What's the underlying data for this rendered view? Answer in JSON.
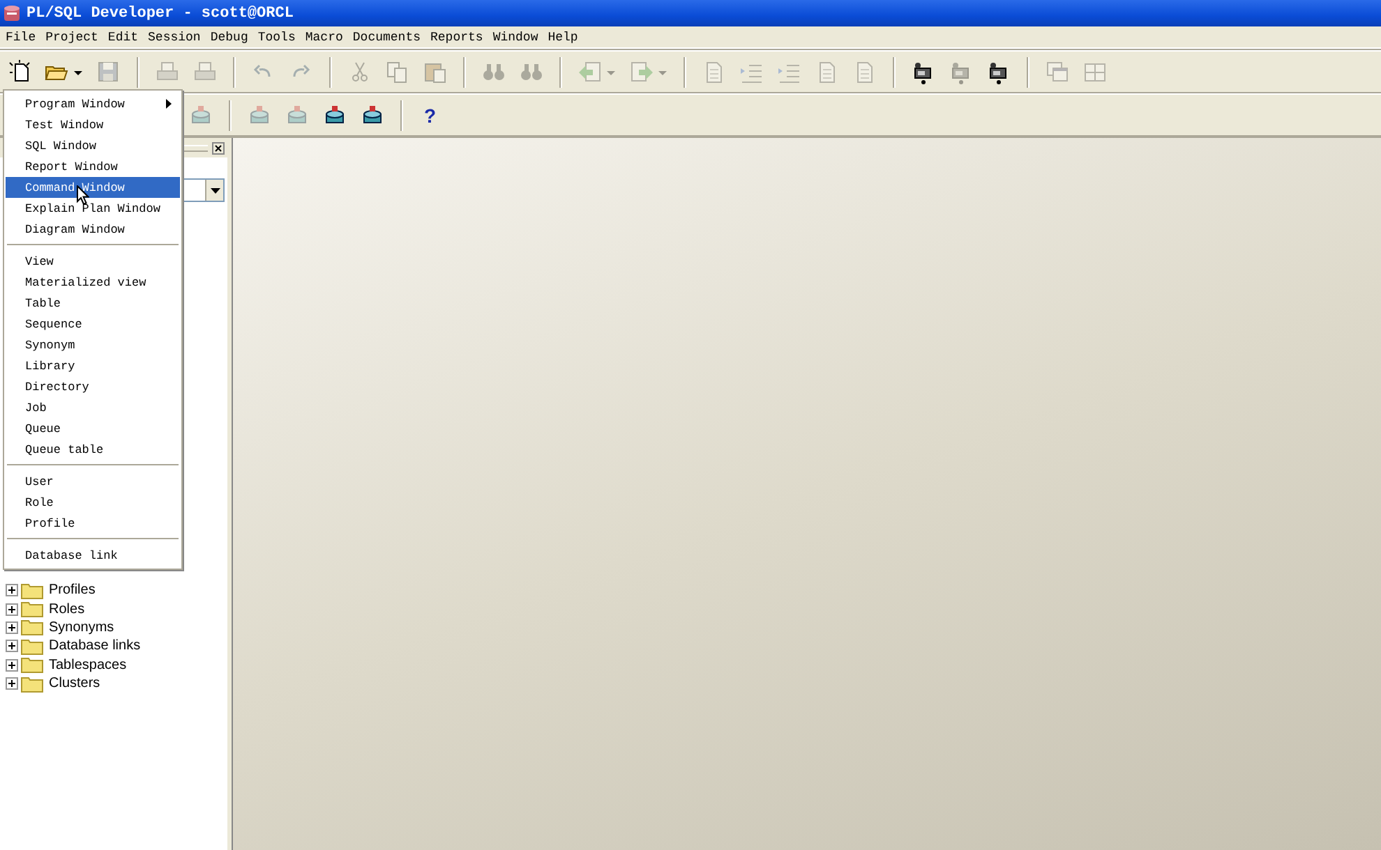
{
  "window": {
    "title": "PL/SQL Developer - scott@ORCL"
  },
  "menu_bar": [
    {
      "label": "File"
    },
    {
      "label": "Project"
    },
    {
      "label": "Edit"
    },
    {
      "label": "Session"
    },
    {
      "label": "Debug"
    },
    {
      "label": "Tools"
    },
    {
      "label": "Macro"
    },
    {
      "label": "Documents"
    },
    {
      "label": "Reports"
    },
    {
      "label": "Window"
    },
    {
      "label": "Help"
    }
  ],
  "toolbars": [
    [
      {
        "kind": "new",
        "disabled": false
      },
      {
        "kind": "open",
        "disabled": false
      },
      {
        "kind": "dropdown",
        "disabled": false
      },
      {
        "kind": "save",
        "disabled": true
      },
      {
        "kind": "separator"
      },
      {
        "kind": "print",
        "disabled": true
      },
      {
        "kind": "print",
        "disabled": true
      },
      {
        "kind": "separator"
      },
      {
        "kind": "undo",
        "disabled": true
      },
      {
        "kind": "redo",
        "disabled": true
      },
      {
        "kind": "separator"
      },
      {
        "kind": "cut",
        "disabled": true
      },
      {
        "kind": "copy",
        "disabled": true
      },
      {
        "kind": "paste",
        "disabled": true
      },
      {
        "kind": "separator"
      },
      {
        "kind": "find",
        "disabled": true
      },
      {
        "kind": "find",
        "disabled": true
      },
      {
        "kind": "separator"
      },
      {
        "kind": "back",
        "disabled": true
      },
      {
        "kind": "dropdown",
        "disabled": true
      },
      {
        "kind": "forward",
        "disabled": true
      },
      {
        "kind": "dropdown",
        "disabled": true
      },
      {
        "kind": "separator"
      },
      {
        "kind": "document",
        "disabled": true
      },
      {
        "kind": "indent",
        "disabled": true
      },
      {
        "kind": "indent",
        "disabled": true
      },
      {
        "kind": "document",
        "disabled": true
      },
      {
        "kind": "document",
        "disabled": true
      },
      {
        "kind": "separator"
      },
      {
        "kind": "camera",
        "disabled": false
      },
      {
        "kind": "camera",
        "disabled": true
      },
      {
        "kind": "camera",
        "disabled": false
      },
      {
        "kind": "separator"
      },
      {
        "kind": "windows",
        "disabled": true
      },
      {
        "kind": "tile",
        "disabled": true
      }
    ],
    [
      {
        "kind": "database",
        "disabled": true
      },
      {
        "kind": "separator"
      },
      {
        "kind": "database",
        "disabled": true
      },
      {
        "kind": "database",
        "disabled": true
      },
      {
        "kind": "database",
        "disabled": false
      },
      {
        "kind": "database",
        "disabled": false
      },
      {
        "kind": "separator"
      },
      {
        "kind": "help",
        "label": "?",
        "disabled": false
      }
    ]
  ],
  "new_menu": {
    "items": [
      {
        "kind": "item",
        "label": "Program Window",
        "submenu": true,
        "selected": false
      },
      {
        "kind": "item",
        "label": "Test Window",
        "selected": false
      },
      {
        "kind": "item",
        "label": "SQL Window",
        "selected": false
      },
      {
        "kind": "item",
        "label": "Report Window",
        "selected": false
      },
      {
        "kind": "item",
        "label": "Command Window",
        "selected": true
      },
      {
        "kind": "item",
        "label": "Explain Plan Window",
        "selected": false
      },
      {
        "kind": "item",
        "label": "Diagram Window",
        "selected": false
      },
      {
        "kind": "separator"
      },
      {
        "kind": "item",
        "label": "View",
        "selected": false
      },
      {
        "kind": "item",
        "label": "Materialized view",
        "selected": false
      },
      {
        "kind": "item",
        "label": "Table",
        "selected": false
      },
      {
        "kind": "item",
        "label": "Sequence",
        "selected": false
      },
      {
        "kind": "item",
        "label": "Synonym",
        "selected": false
      },
      {
        "kind": "item",
        "label": "Library",
        "selected": false
      },
      {
        "kind": "item",
        "label": "Directory",
        "selected": false
      },
      {
        "kind": "item",
        "label": "Job",
        "selected": false
      },
      {
        "kind": "item",
        "label": "Queue",
        "selected": false
      },
      {
        "kind": "item",
        "label": "Queue table",
        "selected": false
      },
      {
        "kind": "separator"
      },
      {
        "kind": "item",
        "label": "User",
        "selected": false
      },
      {
        "kind": "item",
        "label": "Role",
        "selected": false
      },
      {
        "kind": "item",
        "label": "Profile",
        "selected": false
      },
      {
        "kind": "separator"
      },
      {
        "kind": "item",
        "label": "Database link",
        "selected": false
      }
    ]
  },
  "object_tree": {
    "items": [
      {
        "label": "Profiles",
        "expanded": false
      },
      {
        "label": "Roles",
        "expanded": false
      },
      {
        "label": "Synonyms",
        "expanded": false
      },
      {
        "label": "Database links",
        "expanded": false
      },
      {
        "label": "Tablespaces",
        "expanded": false
      },
      {
        "label": "Clusters",
        "expanded": false
      }
    ]
  }
}
